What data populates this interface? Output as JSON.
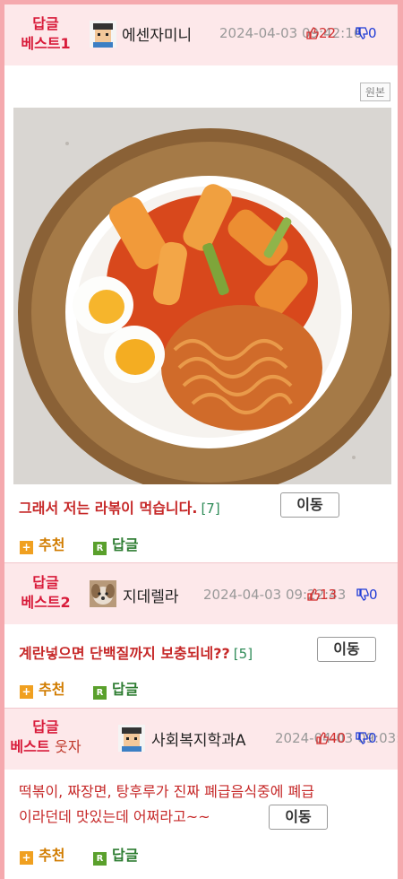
{
  "posts": [
    {
      "rank_line1": "답글",
      "rank_line2": "베스트1",
      "nickname": "에센자미니",
      "date": "2024-04-03 09:42:16",
      "upvotes": "22",
      "downvotes": "0",
      "original_label": "원본",
      "content": "그래서 저는 라볶이 먹습니다.",
      "comment_count": "[7]",
      "move_label": "이동",
      "recommend_label": "추천",
      "reply_label": "답글"
    },
    {
      "rank_line1": "답글",
      "rank_line2": "베스트2",
      "nickname": "지데렐라",
      "date": "2024-04-03 09:22:43",
      "upvotes": "13",
      "downvotes": "0",
      "content": "계란넣으면 단백질까지 보충되네??",
      "comment_count": "[5]",
      "move_label": "이동",
      "recommend_label": "추천",
      "reply_label": "답글"
    },
    {
      "rank_line1": "답글",
      "rank_line2a": "베스트",
      "rank_line2b": "웃자",
      "nickname": "사회복지학과A",
      "date": "2024-04-03 09:03:",
      "upvotes": "40",
      "downvotes": "0",
      "content_line1": "떡볶이, 짜장면, 탕후루가 진짜 폐급음식중에 폐급",
      "content_line2": "이라던데 맛있는데 어쩌라고~~",
      "move_label": "이동",
      "recommend_label": "추천",
      "reply_label": "답글"
    }
  ],
  "icons": {
    "thumb_up": "thumb-up-icon",
    "thumb_down": "thumb-down-icon",
    "recommend": "plus-icon",
    "reply": "r-icon"
  },
  "colors": {
    "border": "#f5a9ae",
    "header_bg": "#fde8ea",
    "rank": "#d81b3a",
    "content": "#c62828",
    "upvote": "#d32f2f",
    "downvote": "#1f3bd6",
    "recommend": "#d17c00",
    "reply": "#2e7d32"
  }
}
